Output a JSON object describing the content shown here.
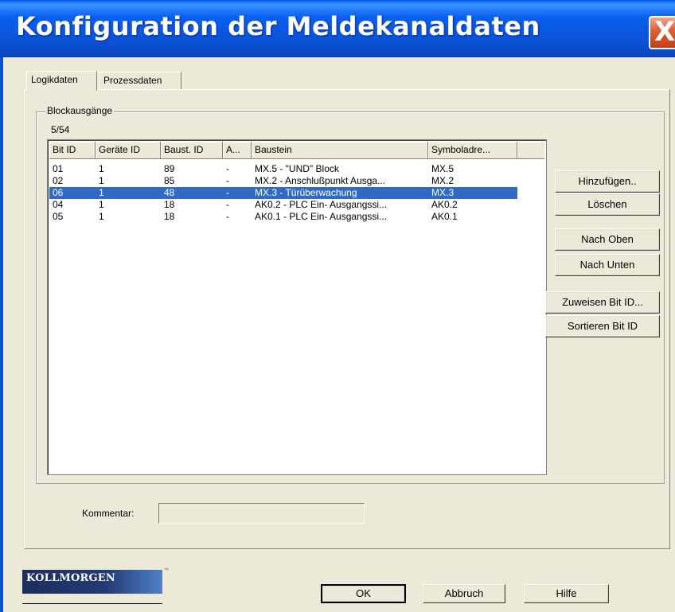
{
  "window": {
    "title": "Konfiguration der Meldekanaldaten",
    "close_glyph": "X"
  },
  "tabs": [
    {
      "label": "Logikdaten",
      "active": true
    },
    {
      "label": "Prozessdaten",
      "active": false
    }
  ],
  "group": {
    "legend": "Blockausgänge",
    "count": "5/54"
  },
  "list": {
    "columns": [
      "Bit ID",
      "Geräte ID",
      "Baust. ID",
      "A...",
      "Baustein",
      "Symboladre..."
    ],
    "rows": [
      {
        "bit_id": "01",
        "geraete_id": "1",
        "baust_id": "89",
        "a": "-",
        "baustein": "MX.5 - \"UND\" Block",
        "symbol": "MX.5",
        "selected": false
      },
      {
        "bit_id": "02",
        "geraete_id": "1",
        "baust_id": "85",
        "a": "-",
        "baustein": "MX.2 - Anschlußpunkt Ausga...",
        "symbol": "MX.2",
        "selected": false
      },
      {
        "bit_id": "06",
        "geraete_id": "1",
        "baust_id": "48",
        "a": "-",
        "baustein": "MX.3 - Türüberwachung",
        "symbol": "MX.3",
        "selected": true
      },
      {
        "bit_id": "04",
        "geraete_id": "1",
        "baust_id": "18",
        "a": "-",
        "baustein": "AK0.2 - PLC Ein- Ausgangssi...",
        "symbol": "AK0.2",
        "selected": false
      },
      {
        "bit_id": "05",
        "geraete_id": "1",
        "baust_id": "18",
        "a": "-",
        "baustein": "AK0.1 - PLC Ein- Ausgangssi...",
        "symbol": "AK0.1",
        "selected": false
      }
    ],
    "selection_color": "#316ac5"
  },
  "side_buttons": {
    "add": "Hinzufügen..",
    "delete": "Löschen",
    "move_up": "Nach Oben",
    "move_down": "Nach Unten",
    "assign_bit_id": "Zuweisen Bit ID...",
    "sort_bit_id": "Sortieren Bit ID"
  },
  "comment": {
    "label": "Kommentar:",
    "value": ""
  },
  "footer": {
    "logo": "KOLLMORGEN",
    "logo_tm": "™",
    "ok": "OK",
    "cancel": "Abbruch",
    "help": "Hilfe"
  }
}
